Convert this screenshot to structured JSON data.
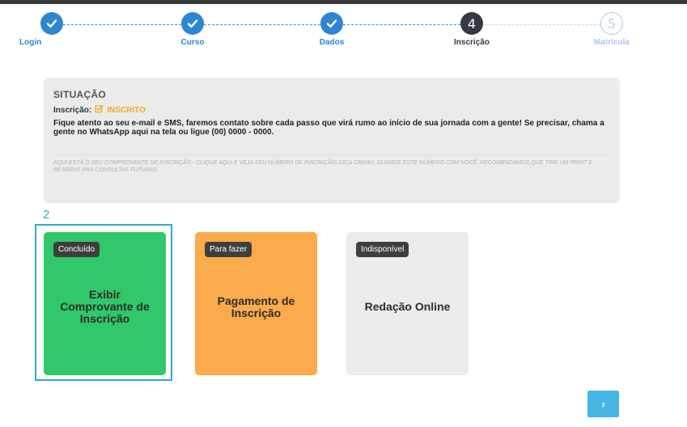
{
  "stepper": {
    "steps": [
      {
        "label": "Login",
        "state": "done"
      },
      {
        "label": "Curso",
        "state": "done"
      },
      {
        "label": "Dados",
        "state": "done"
      },
      {
        "label": "Inscrição",
        "state": "current",
        "number": "4"
      },
      {
        "label": "Matrícula",
        "state": "future",
        "number": "5"
      }
    ]
  },
  "situation": {
    "title": "SITUAÇÃO",
    "status_label": "Inscrição:",
    "status_icon": "edit-check-icon",
    "status_value": "INSCRITO",
    "message": "Fique atento ao seu e-mail e SMS, faremos contato sobre cada passo que virá rumo ao início de sua jornada com a gente! Se precisar, chama a gente no WhatsApp aqui na tela ou ligue (00) 0000 - 0000.",
    "note": "AQUI ESTÁ O SEU COMPROVANTE DE INSCRIÇÃO - CLIQUE AQUI E VEJA SEU NÚMERO DE INSCRIÇÃO! DICA CRM4U: GUARDE ESTE NÚMERO COM VOCÊ. RECOMENDAMOS QUE TIRE UM PRINT E RESERVE PRA CONSULTAS FUTURAS."
  },
  "annotation": {
    "marker": "2"
  },
  "cards": [
    {
      "badge": "Concluído",
      "title": "Exibir Comprovante de Inscrição",
      "color": "#31c76b"
    },
    {
      "badge": "Para fazer",
      "title": "Pagamento de Inscrição",
      "color": "#fbab4b"
    },
    {
      "badge": "Indisponível",
      "title": "Redação Online",
      "color": "#ebebeb"
    }
  ],
  "nav": {
    "next_icon": "chevron-right-icon",
    "next_glyph": "›"
  },
  "colors": {
    "accent": "#2e86d1",
    "highlight": "#2aa9d8",
    "status": "#f5a623"
  }
}
